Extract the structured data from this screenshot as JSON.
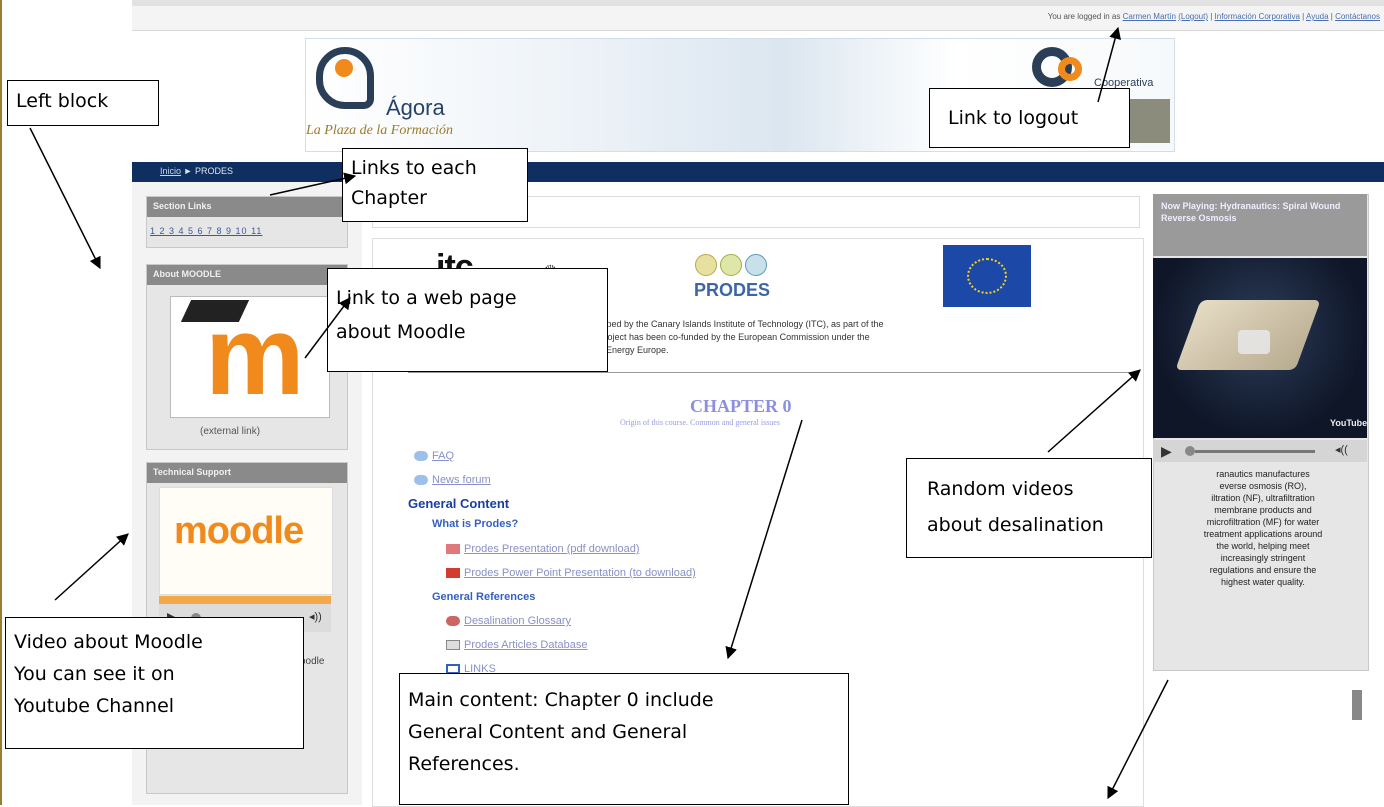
{
  "topbar": {
    "logged_in_prefix": "You are logged in as",
    "user": "Carmen Martín",
    "logout": "(Logout)",
    "links": [
      "Información Corporativa",
      "Ayuda",
      "Contáctanos"
    ]
  },
  "banner": {
    "name": "Ágora",
    "tagline": "La Plaza de la Formación",
    "partner": "Cooperativa"
  },
  "breadcrumb": {
    "home": "Inicio",
    "sep": "►",
    "current": "PRODES"
  },
  "left": {
    "section_links": {
      "title": "Section Links",
      "numbers": "1 2 3 4 5 6 7 8 9 10 11"
    },
    "about": {
      "title": "About MOODLE",
      "caption": "(external link)"
    },
    "support": {
      "title": "Technical Support",
      "video_word": "moodle",
      "fragment": "oodle"
    }
  },
  "main": {
    "logos": {
      "itc": "itc",
      "prodes": "PRODES"
    },
    "desc_lines": [
      "developed by the Canary Islands Institute of Technology (ITC), as part of the",
      "This project has been co-funded by the European Commission under the",
      "lligent Energy Europe."
    ],
    "chapter_title": "CHAPTER 0",
    "chapter_sub": "Origin of this course. Common and general issues",
    "links": {
      "faq": "FAQ",
      "news": "News forum"
    },
    "general_content": "General Content",
    "what_is": "What is Prodes?",
    "what_items": [
      "Prodes Presentation (pdf download)",
      "Prodes Power Point Presentation (to download)"
    ],
    "general_refs": "General References",
    "ref_items": [
      "Desalination Glossary",
      "Prodes Articles Database",
      "LINKS"
    ]
  },
  "right": {
    "now_playing": "Now Playing: Hydranautics: Spiral Wound Reverse Osmosis",
    "yt": "YouTube",
    "description_lines": [
      "ranautics manufactures",
      "everse osmosis (RO),",
      "iltration (NF), ultrafiltration",
      "membrane products and",
      "microfiltration (MF) for water",
      "treatment applications around",
      "the world, helping meet",
      "increasingly stringent",
      "regulations and ensure the",
      "highest water quality."
    ]
  },
  "callouts": {
    "left_block": "Left block",
    "links_chapter": [
      "Links to each",
      "Chapter"
    ],
    "web_page": [
      "Link to a web page",
      "about Moodle"
    ],
    "logout": "Link to logout",
    "random_videos": [
      "Random videos",
      "about desalination"
    ],
    "video_moodle": [
      "Video about Moodle",
      "You can see it on",
      "Youtube Channel"
    ],
    "main_content": [
      "Main content: Chapter 0 include",
      "General Content  and General",
      "References."
    ]
  },
  "colors": {
    "navbar": "#0f2f60",
    "accent": "#f08a1c",
    "links": "#3460c0"
  }
}
